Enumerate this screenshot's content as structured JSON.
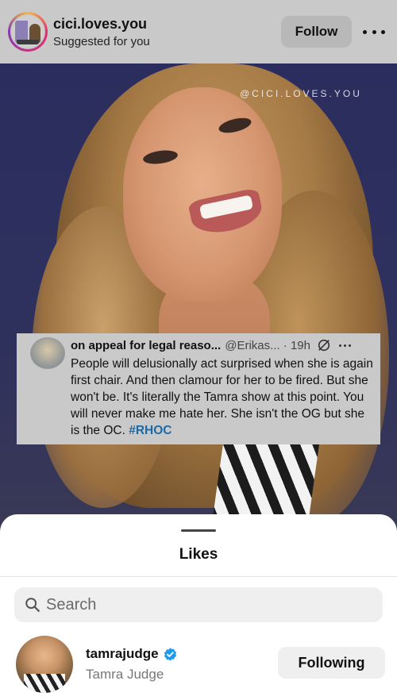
{
  "post_header": {
    "username": "cici.loves.you",
    "subtitle": "Suggested for you",
    "follow_label": "Follow",
    "more_icon": "more-horizontal-icon"
  },
  "post_image": {
    "watermark": "@CICI.LOVES.YOU"
  },
  "tweet": {
    "display_name": "on appeal for legal reaso...",
    "handle_time": "@Erikas... · 19h",
    "body": "People will delusionally act surprised when she is again first chair. And then clamour for her to be fired. But she won't be. It's literally the Tamra show at this point.  You will never make me hate her. She isn't the OG but she is the OC.",
    "hashtag": "#RHOC"
  },
  "likes_sheet": {
    "title": "Likes",
    "search": {
      "placeholder": "Search",
      "value": ""
    },
    "users": [
      {
        "username": "tamrajudge",
        "name": "Tamra Judge",
        "verified": true,
        "button_label": "Following"
      }
    ]
  },
  "colors": {
    "overlay": "#c9c9c9",
    "verified": "#1d9bf0",
    "hashtag": "#1a6aa8"
  }
}
